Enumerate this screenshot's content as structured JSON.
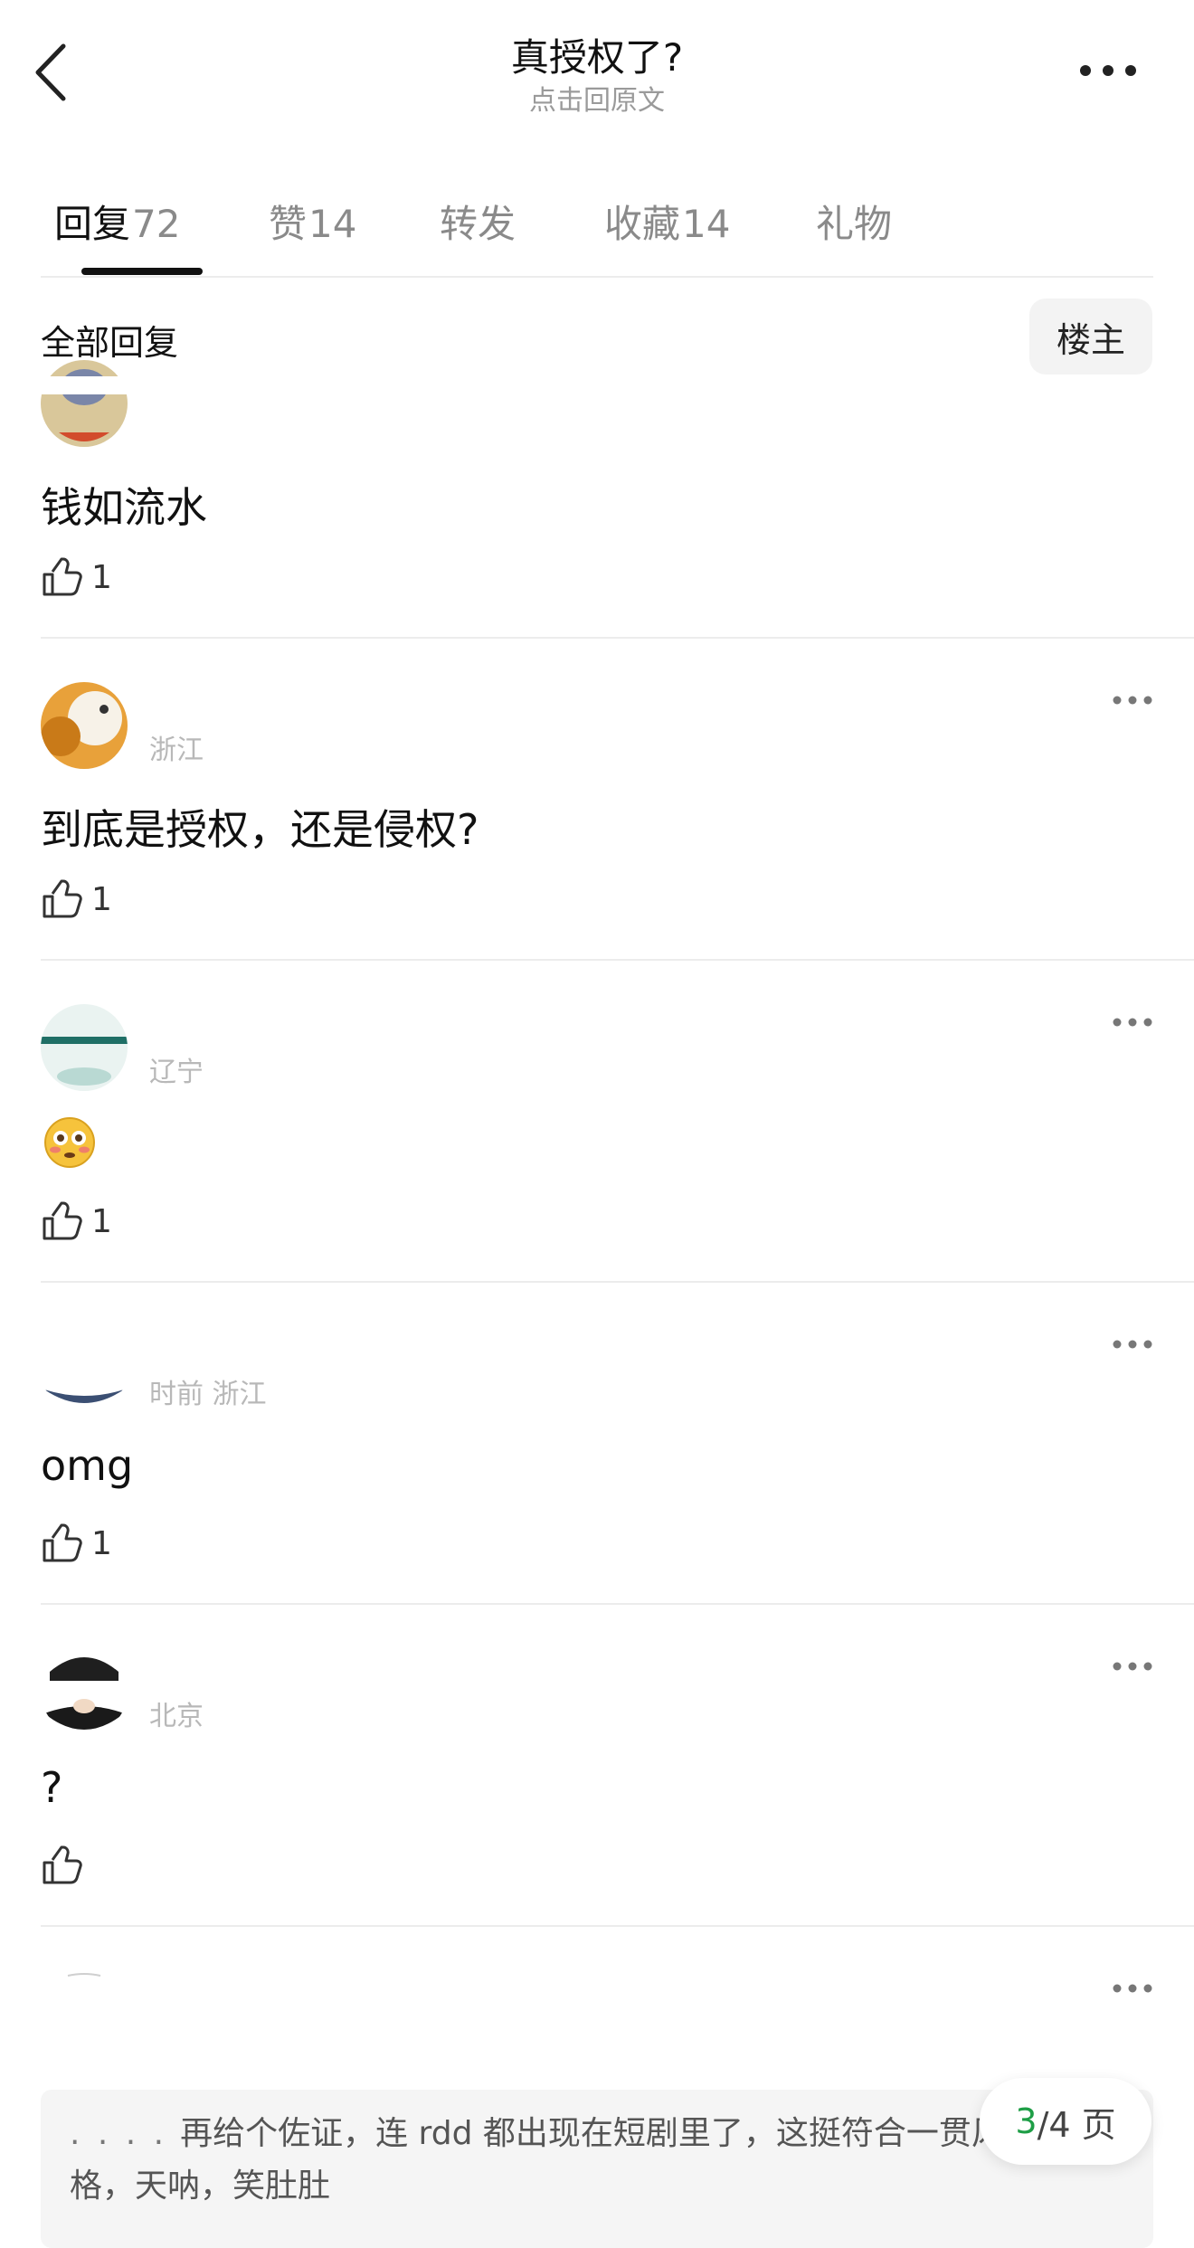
{
  "header": {
    "title": "真授权了?",
    "subtitle": "点击回原文"
  },
  "tabs": [
    {
      "label": "回复",
      "count": "72",
      "active": true
    },
    {
      "label": "赞",
      "count": "14",
      "active": false
    },
    {
      "label": "转发",
      "count": "",
      "active": false
    },
    {
      "label": "收藏",
      "count": "14",
      "active": false
    },
    {
      "label": "礼物",
      "count": "",
      "active": false
    }
  ],
  "filter": {
    "all_replies_label": "全部回复",
    "op_label": "楼主"
  },
  "comments": [
    {
      "meta": "",
      "text": "钱如流水",
      "likes": "1"
    },
    {
      "meta": "浙江",
      "text": "到底是授权，还是侵权?",
      "likes": "1"
    },
    {
      "meta": "辽宁",
      "text": "",
      "emoji": "flushed-face",
      "likes": "1"
    },
    {
      "meta": "时前 浙江",
      "text": "omg",
      "likes": "1"
    },
    {
      "meta": "北京",
      "text": "?",
      "likes": ""
    },
    {
      "meta": "",
      "text": "",
      "likes": ""
    }
  ],
  "quote": {
    "text": "再给个佐证，连 rdd 都出现在短剧里了，这挺符合一贯风格，天呐，笑肚肚"
  },
  "pagination": {
    "current": "3",
    "total_text": "/4 页"
  },
  "colors": {
    "accent_green": "#1e9e46",
    "divider": "#ececec",
    "muted_text": "#9a9a9a"
  }
}
